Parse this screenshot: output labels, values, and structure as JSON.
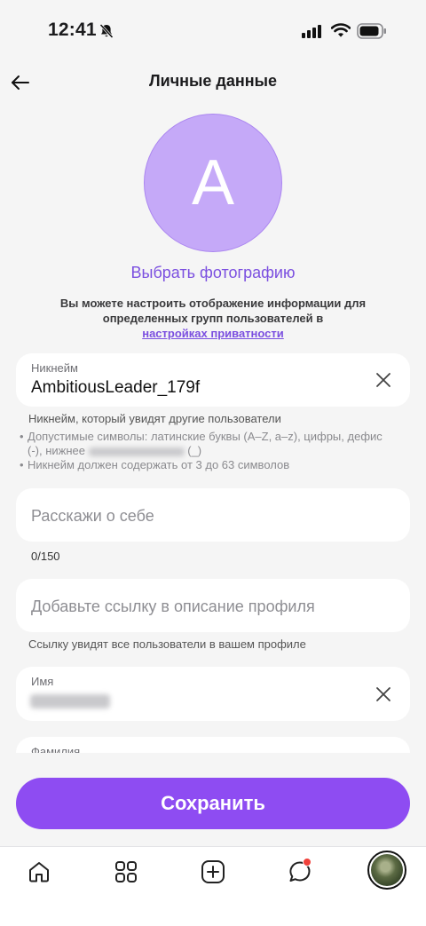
{
  "status_bar": {
    "time": "12:41",
    "icons": [
      "bell-slash-icon",
      "signal-icon",
      "wifi-icon",
      "battery-icon"
    ]
  },
  "header": {
    "title": "Личные данные",
    "back_icon": "arrow-left-icon"
  },
  "avatar": {
    "letter": "A",
    "color": "#c5a9f8"
  },
  "choose_photo_label": "Выбрать фотографию",
  "privacy": {
    "text": "Вы можете настроить отображение информации для определенных групп пользователей в",
    "link": "настройках приватности"
  },
  "nickname": {
    "label": "Никнейм",
    "value": "AmbitiousLeader_179f",
    "hint": "Никнейм, который увидят другие пользователи",
    "rules": [
      "Допустимые символы: латинские буквы (A–Z, a–z), цифры, дефис (-), нижнее",
      "Никнейм должен содержать от 3 до 63 символов"
    ],
    "rule_suffix": "(_)"
  },
  "about": {
    "placeholder": "Расскажи о себе",
    "counter": "0/150"
  },
  "link_field": {
    "placeholder": "Добавьте ссылку в описание профиля",
    "hint": "Ссылку увидят все пользователи в вашем профиле"
  },
  "first_name": {
    "label": "Имя"
  },
  "last_name": {
    "label": "Фамилия"
  },
  "save_label": "Сохранить",
  "tab_bar": {
    "items": [
      "home-icon",
      "grid-icon",
      "add-icon",
      "chat-icon",
      "profile-avatar"
    ]
  },
  "colors": {
    "accent": "#8e4cf2",
    "link": "#7b4fe0",
    "badge": "#f0413b"
  }
}
